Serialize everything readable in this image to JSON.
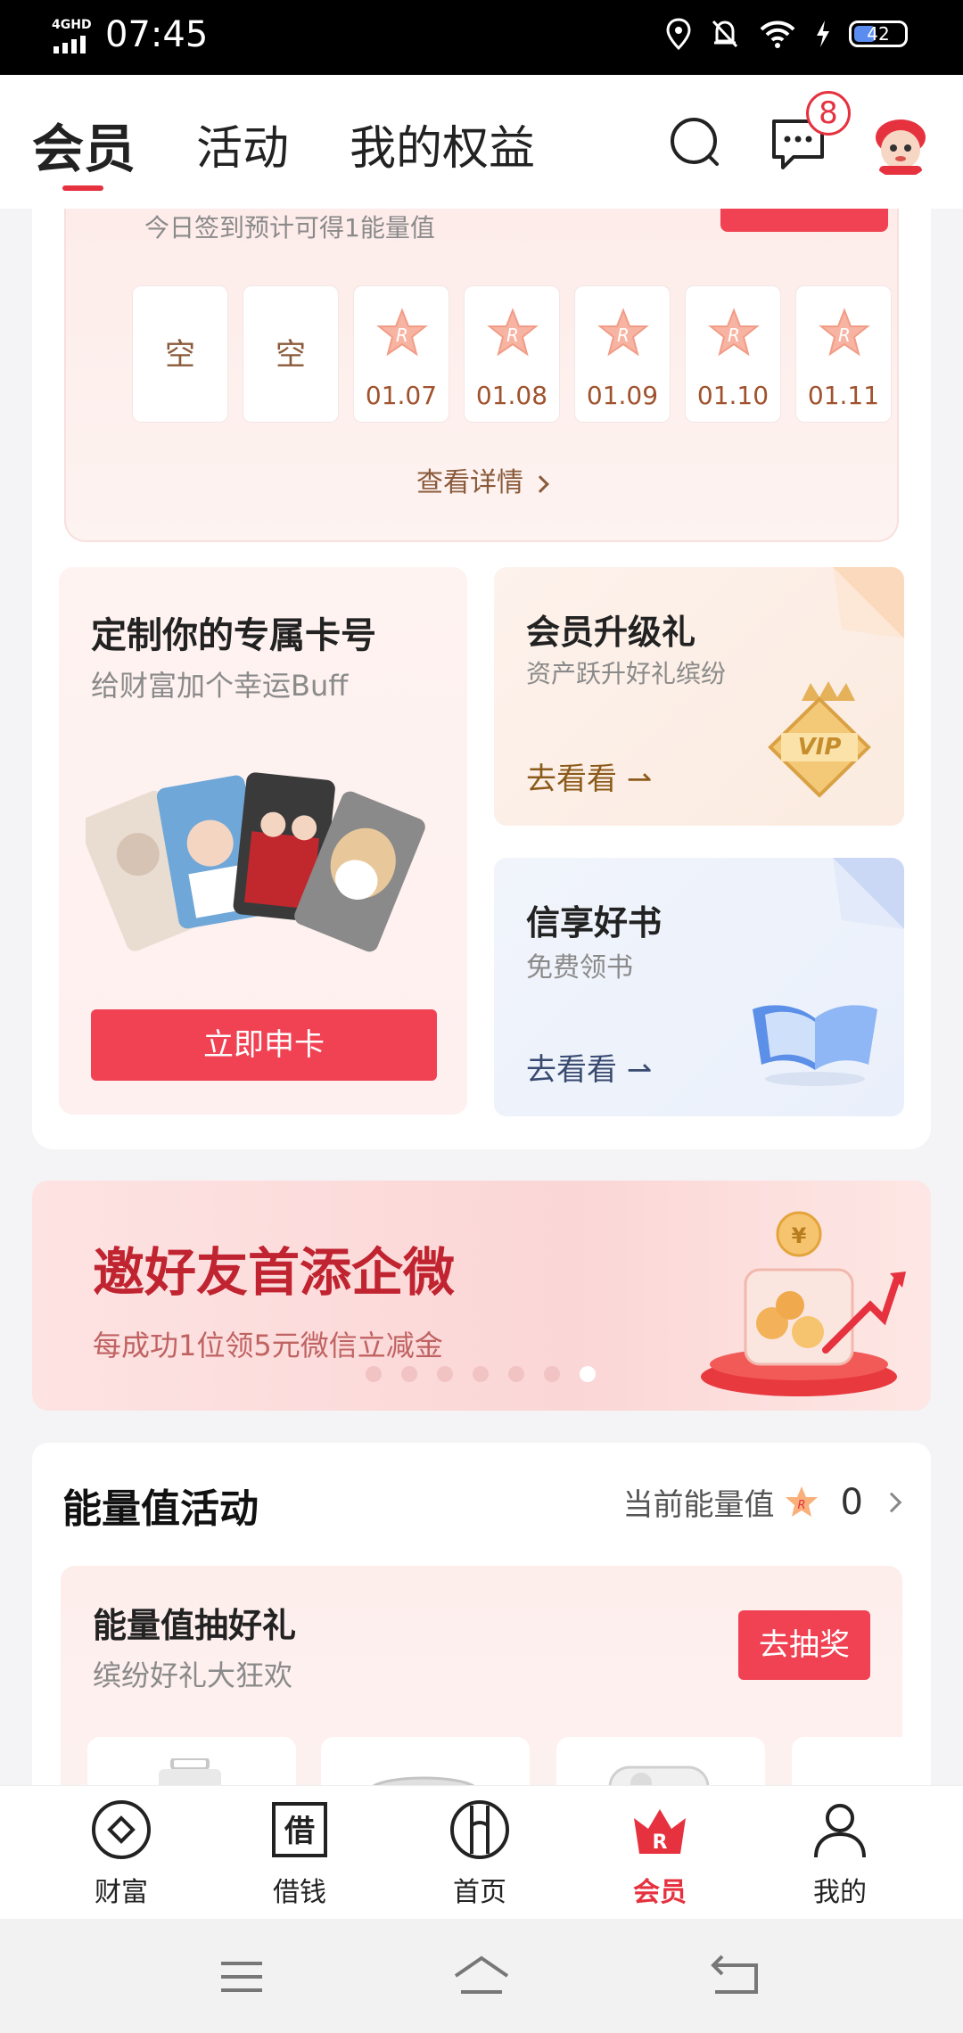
{
  "status_bar": {
    "network": "4GHD",
    "time": "07:45",
    "battery": "42"
  },
  "header": {
    "tabs": [
      {
        "label": "会员",
        "active": true
      },
      {
        "label": "活动",
        "active": false
      },
      {
        "label": "我的权益",
        "active": false
      }
    ],
    "message_badge": "8"
  },
  "checkin": {
    "tip": "今日签到预计可得1能量值",
    "days": [
      {
        "label": "空",
        "date": ""
      },
      {
        "label": "空",
        "date": ""
      },
      {
        "label": "",
        "date": "01.07"
      },
      {
        "label": "",
        "date": "01.08"
      },
      {
        "label": "",
        "date": "01.09"
      },
      {
        "label": "",
        "date": "01.10"
      },
      {
        "label": "",
        "date": "01.11"
      }
    ],
    "details_link": "查看详情"
  },
  "custom_card": {
    "title": "定制你的专属卡号",
    "subtitle": "给财富加个幸运Buff",
    "button": "立即申卡"
  },
  "vip_card": {
    "title": "会员升级礼",
    "subtitle": "资产跃升好礼缤纷",
    "link": "去看看 ⇀",
    "badge_text": "VIP"
  },
  "book_card": {
    "title": "信享好书",
    "subtitle": "免费领书",
    "link": "去看看 ⇀"
  },
  "banner": {
    "title": "邀好友首添企微",
    "subtitle": "每成功1位领5元微信立减金",
    "dots_total": 7,
    "dots_active_index": 6
  },
  "energy": {
    "title": "能量值活动",
    "current_label": "当前能量值",
    "current_value": "0",
    "lottery": {
      "title": "能量值抽好礼",
      "subtitle": "缤纷好礼大狂欢",
      "button": "去抽奖"
    }
  },
  "bottom_nav": [
    {
      "label": "财富",
      "icon": "wealth-icon",
      "active": false
    },
    {
      "label": "借钱",
      "icon": "borrow-icon",
      "active": false
    },
    {
      "label": "首页",
      "icon": "home-icon",
      "active": false
    },
    {
      "label": "会员",
      "icon": "member-crown-icon",
      "active": true
    },
    {
      "label": "我的",
      "icon": "profile-icon",
      "active": false
    }
  ],
  "colors": {
    "accent": "#e6313f",
    "button_red": "#f04253",
    "gold_text": "#8c5a1a"
  }
}
